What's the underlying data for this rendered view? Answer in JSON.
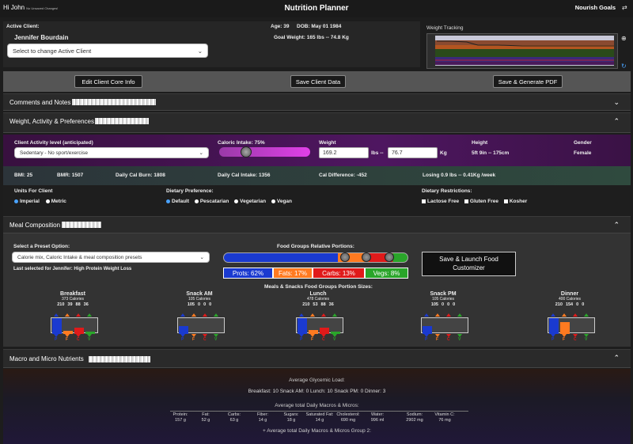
{
  "topbar": {
    "greeting": "Hi John",
    "unsaved": "No Unsaved Changes!",
    "title": "Nutrition Planner",
    "brand": "Nourish Goals"
  },
  "client": {
    "label": "Active Client:",
    "name": "Jennifer Bourdain",
    "age": "Age: 39",
    "dob": "DOB: May 01 1984",
    "goal_weight": "Goal Weight: 165 lbs  --  74.8 Kg",
    "select_placeholder": "Select to change Active Client"
  },
  "weight_tracking": {
    "title": "Weight Tracking"
  },
  "toolbar": {
    "edit": "Edit Client Core Info",
    "save": "Save Client Data",
    "pdf": "Save & Generate PDF"
  },
  "sections": {
    "comments": "Comments and Notes",
    "weight": "Weight, Activity & Preferences",
    "meal": "Meal Composition",
    "macro": "Macro and Micro Nutrients"
  },
  "activity": {
    "label": "Client Activity level (anticipated)",
    "value": "Sedentary - No sport/exercise",
    "caloric_label": "Caloric Intake:",
    "caloric_value": "75%",
    "caloric_percent": 75,
    "weight_label": "Weight",
    "weight_lbs": "169.2",
    "weight_kg": "76.7",
    "lbs_unit": "lbs  --",
    "kg_unit": "Kg",
    "height_label": "Height",
    "height_value": "5ft 9in  --  175cm",
    "gender_label": "Gender",
    "gender_value": "Female"
  },
  "stats": {
    "bmi": "BMI: 25",
    "bmr": "BMR: 1507",
    "burn": "Daily Cal Burn: 1808",
    "intake": "Daily Cal Intake: 1356",
    "diff": "Cal Difference: -452",
    "losing": "Losing 0.9 lbs  --  0.41Kg /week"
  },
  "prefs": {
    "units_label": "Units For Client",
    "units": [
      "Imperial",
      "Metric"
    ],
    "diet_label": "Dietary Preference:",
    "diets": [
      "Default",
      "Pescatarian",
      "Vegetarian",
      "Vegan"
    ],
    "restrict_label": "Dietary Restrictions:",
    "restrictions": [
      "Lactose Free",
      "Gluten Free",
      "Kosher"
    ]
  },
  "meal_comp": {
    "preset_label": "Select a Preset Option:",
    "preset_value": "Calorie mix, Caloric Intake & meal composition presets",
    "last_selected": "Last selected for Jennifer: High Protein Weight Loss",
    "portions_title": "Food Groups Relative Portions:",
    "prots": "Prots:  62%",
    "fats": "Fats:  17%",
    "carbs": "Carbs:  13%",
    "vegs": "Vegs:   8%",
    "launch": "Save & Launch Food Customizer",
    "sizes_title": "Meals & Snacks Food Groups Portion Sizes:",
    "meals": [
      {
        "name": "Breakfast",
        "cal": "373 Calories",
        "p": "210",
        "f": "39",
        "c": "88",
        "v": "36"
      },
      {
        "name": "Snack AM",
        "cal": "105 Calories",
        "p": "105",
        "f": "0",
        "c": "0",
        "v": "0"
      },
      {
        "name": "Lunch",
        "cal": "478 Calories",
        "p": "210",
        "f": "53",
        "c": "88",
        "v": "36"
      },
      {
        "name": "Snack PM",
        "cal": "105 Calories",
        "p": "105",
        "f": "0",
        "c": "0",
        "v": "0"
      },
      {
        "name": "Dinner",
        "cal": "400 Calories",
        "p": "210",
        "f": "154",
        "c": "0",
        "v": "0"
      }
    ]
  },
  "macros": {
    "gl_title": "Average Glycemic Load:",
    "gl_values": "Breakfast: 10  Snack AM: 0  Lunch: 10  Snack PM: 0  Dinner: 3",
    "daily_title": "Average total Daily Macros & Micros:",
    "nutrients": [
      {
        "name": "Protein:",
        "value": "157 g"
      },
      {
        "name": "Fat:",
        "value": "52 g"
      },
      {
        "name": "Carbs:",
        "value": "63 g"
      },
      {
        "name": "Fiber:",
        "value": "14 g"
      },
      {
        "name": "Sugars:",
        "value": "18 g"
      },
      {
        "name": "Saturated Fat:",
        "value": "14 g"
      },
      {
        "name": "Cholesterol:",
        "value": "690 mg"
      },
      {
        "name": "Water:",
        "value": "996 ml"
      },
      {
        "name": "Sodium:",
        "value": "2902 mg"
      },
      {
        "name": "Vitamin C:",
        "value": "76 mg"
      }
    ],
    "group2": "+  Average total Daily Macros & Micros Group 2:"
  },
  "colors": {
    "protein": "#1a3ad0",
    "fat": "#ff7a20",
    "carb": "#e01a1a",
    "veg": "#2aa52a",
    "purple": "#4e1660"
  }
}
